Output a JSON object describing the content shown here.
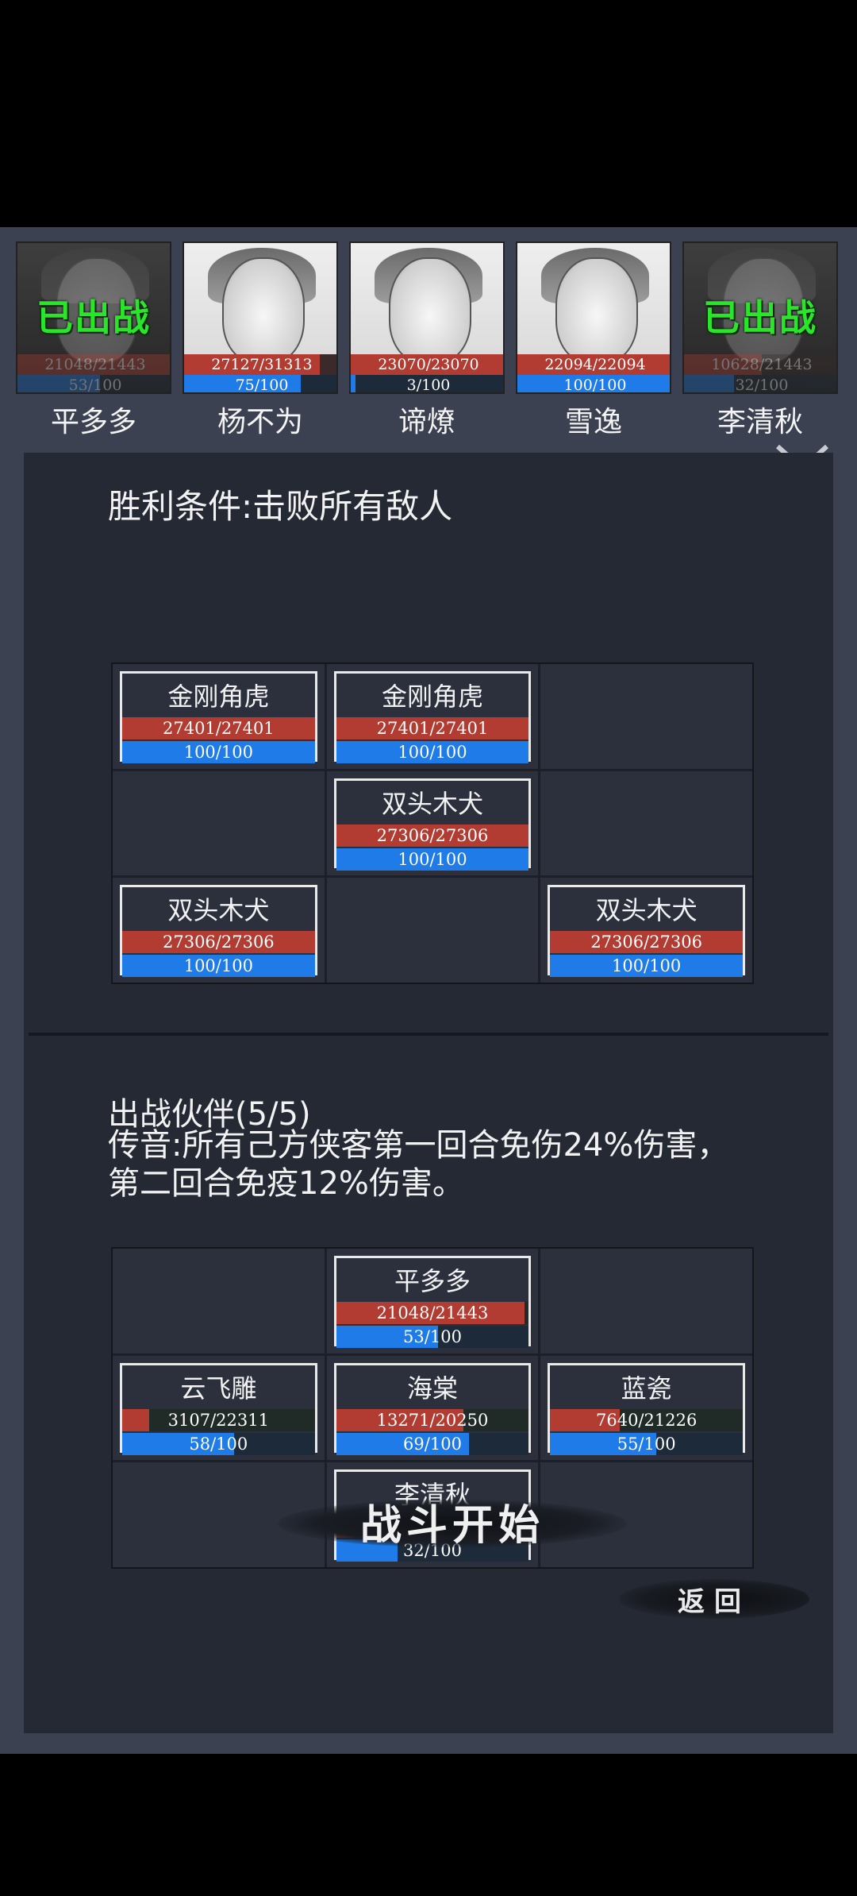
{
  "roster": [
    {
      "name": "平多多",
      "hp": "21048/21443",
      "hp_pct": 98,
      "mp": "53/100",
      "mp_pct": 53,
      "status": "已出战"
    },
    {
      "name": "杨不为",
      "hp": "27127/31313",
      "hp_pct": 87,
      "mp": "75/100",
      "mp_pct": 75,
      "status": ""
    },
    {
      "name": "谛燎",
      "hp": "23070/23070",
      "hp_pct": 100,
      "mp": "3/100",
      "mp_pct": 3,
      "status": ""
    },
    {
      "name": "雪逸",
      "hp": "22094/22094",
      "hp_pct": 100,
      "mp": "100/100",
      "mp_pct": 100,
      "status": ""
    },
    {
      "name": "李清秋",
      "hp": "10628/21443",
      "hp_pct": 50,
      "mp": "32/100",
      "mp_pct": 32,
      "status": "已出战"
    }
  ],
  "victory_condition": "胜利条件:击败所有敌人",
  "enemy_grid": [
    {
      "name": "金刚角虎",
      "hp": "27401/27401",
      "hp_pct": 100,
      "mp": "100/100",
      "mp_pct": 100
    },
    {
      "name": "金刚角虎",
      "hp": "27401/27401",
      "hp_pct": 100,
      "mp": "100/100",
      "mp_pct": 100
    },
    null,
    null,
    {
      "name": "双头木犬",
      "hp": "27306/27306",
      "hp_pct": 100,
      "mp": "100/100",
      "mp_pct": 100
    },
    null,
    {
      "name": "双头木犬",
      "hp": "27306/27306",
      "hp_pct": 100,
      "mp": "100/100",
      "mp_pct": 100
    },
    null,
    {
      "name": "双头木犬",
      "hp": "27306/27306",
      "hp_pct": 100,
      "mp": "100/100",
      "mp_pct": 100
    }
  ],
  "party_title": "出战伙伴(5/5)",
  "party_effect": "传音:所有己方侠客第一回合免伤24%伤害，第二回合免疫12%伤害。",
  "party_grid": [
    null,
    {
      "name": "平多多",
      "hp": "21048/21443",
      "hp_pct": 98,
      "mp": "53/100",
      "mp_pct": 53
    },
    null,
    {
      "name": "云飞雕",
      "hp": "3107/22311",
      "hp_pct": 14,
      "mp": "58/100",
      "mp_pct": 58
    },
    {
      "name": "海棠",
      "hp": "13271/20250",
      "hp_pct": 66,
      "mp": "69/100",
      "mp_pct": 69
    },
    {
      "name": "蓝瓷",
      "hp": "7640/21226",
      "hp_pct": 36,
      "mp": "55/100",
      "mp_pct": 55
    },
    null,
    {
      "name": "李清秋",
      "hp": "10628/21443",
      "hp_pct": 50,
      "mp": "32/100",
      "mp_pct": 32
    },
    null
  ],
  "start_button": "战斗开始",
  "back_button": "返回",
  "colors": {
    "hp": "#b23b32",
    "mp": "#1f7be8",
    "deployed": "#2ae62a",
    "panel": "#252934"
  }
}
